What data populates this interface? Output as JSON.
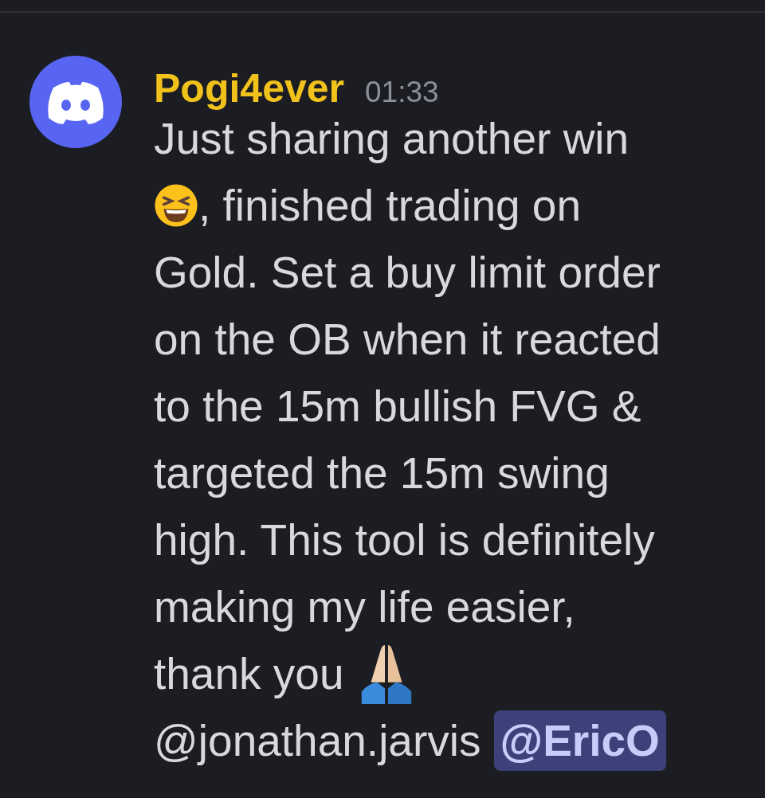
{
  "message": {
    "author": "Pogi4ever",
    "time": "01:33",
    "lines": [
      [
        {
          "kind": "text",
          "text": "Just sharing another win"
        }
      ],
      [
        {
          "kind": "squint-emoji"
        },
        {
          "kind": "text",
          "text": ", finished trading on"
        }
      ],
      [
        {
          "kind": "text",
          "text": "Gold. Set a buy limit order"
        }
      ],
      [
        {
          "kind": "text",
          "text": "on the OB when it reacted"
        }
      ],
      [
        {
          "kind": "text",
          "text": "to the 15m bullish FVG &"
        }
      ],
      [
        {
          "kind": "text",
          "text": "targeted the 15m swing"
        }
      ],
      [
        {
          "kind": "text",
          "text": "high. This tool is definitely"
        }
      ],
      [
        {
          "kind": "text",
          "text": "making my life easier,"
        }
      ],
      [
        {
          "kind": "text",
          "text": "thank you"
        },
        {
          "kind": "pray-emoji"
        }
      ],
      [
        {
          "kind": "mention",
          "text": "@jonathan.jarvis",
          "highlighted": false
        },
        {
          "kind": "mention",
          "text": "@EricO",
          "highlighted": true
        }
      ]
    ]
  }
}
